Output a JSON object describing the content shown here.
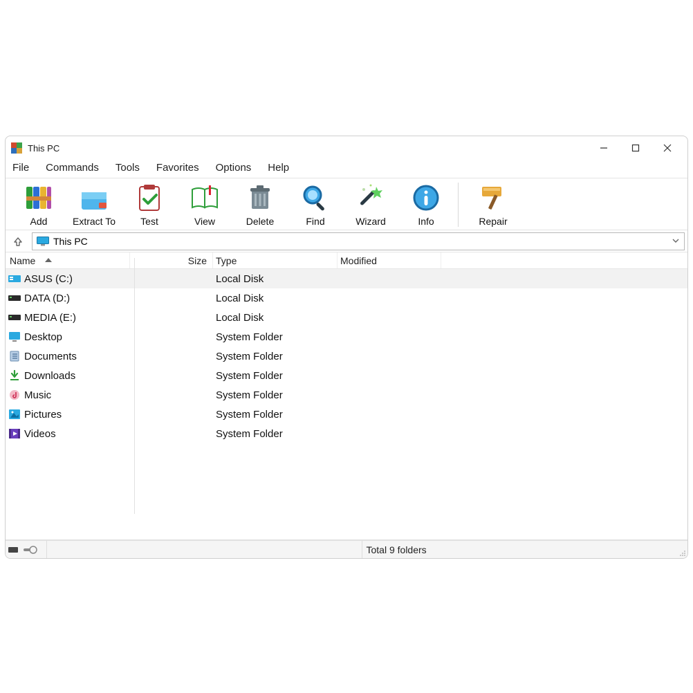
{
  "window_title": "This PC",
  "menus": [
    "File",
    "Commands",
    "Tools",
    "Favorites",
    "Options",
    "Help"
  ],
  "toolbar": [
    {
      "label": "Add",
      "icon": "books"
    },
    {
      "label": "Extract To",
      "icon": "folder-extract"
    },
    {
      "label": "Test",
      "icon": "clipboard-check"
    },
    {
      "label": "View",
      "icon": "book-open"
    },
    {
      "label": "Delete",
      "icon": "trash"
    },
    {
      "label": "Find",
      "icon": "magnifier"
    },
    {
      "label": "Wizard",
      "icon": "wand"
    },
    {
      "label": "Info",
      "icon": "info-circle"
    },
    {
      "label": "Repair",
      "icon": "hammer"
    }
  ],
  "address": "This PC",
  "columns": {
    "name": "Name",
    "size": "Size",
    "type": "Type",
    "modified": "Modified"
  },
  "items": [
    {
      "name": "ASUS (C:)",
      "type": "Local Disk",
      "icon": "disk-blue",
      "selected": true
    },
    {
      "name": "DATA (D:)",
      "type": "Local Disk",
      "icon": "disk-dark"
    },
    {
      "name": "MEDIA (E:)",
      "type": "Local Disk",
      "icon": "disk-dark"
    },
    {
      "name": "Desktop",
      "type": "System Folder",
      "icon": "desktop"
    },
    {
      "name": "Documents",
      "type": "System Folder",
      "icon": "doc"
    },
    {
      "name": "Downloads",
      "type": "System Folder",
      "icon": "download"
    },
    {
      "name": "Music",
      "type": "System Folder",
      "icon": "music"
    },
    {
      "name": "Pictures",
      "type": "System Folder",
      "icon": "picture"
    },
    {
      "name": "Videos",
      "type": "System Folder",
      "icon": "video"
    }
  ],
  "status": {
    "text": "Total 9 folders"
  }
}
